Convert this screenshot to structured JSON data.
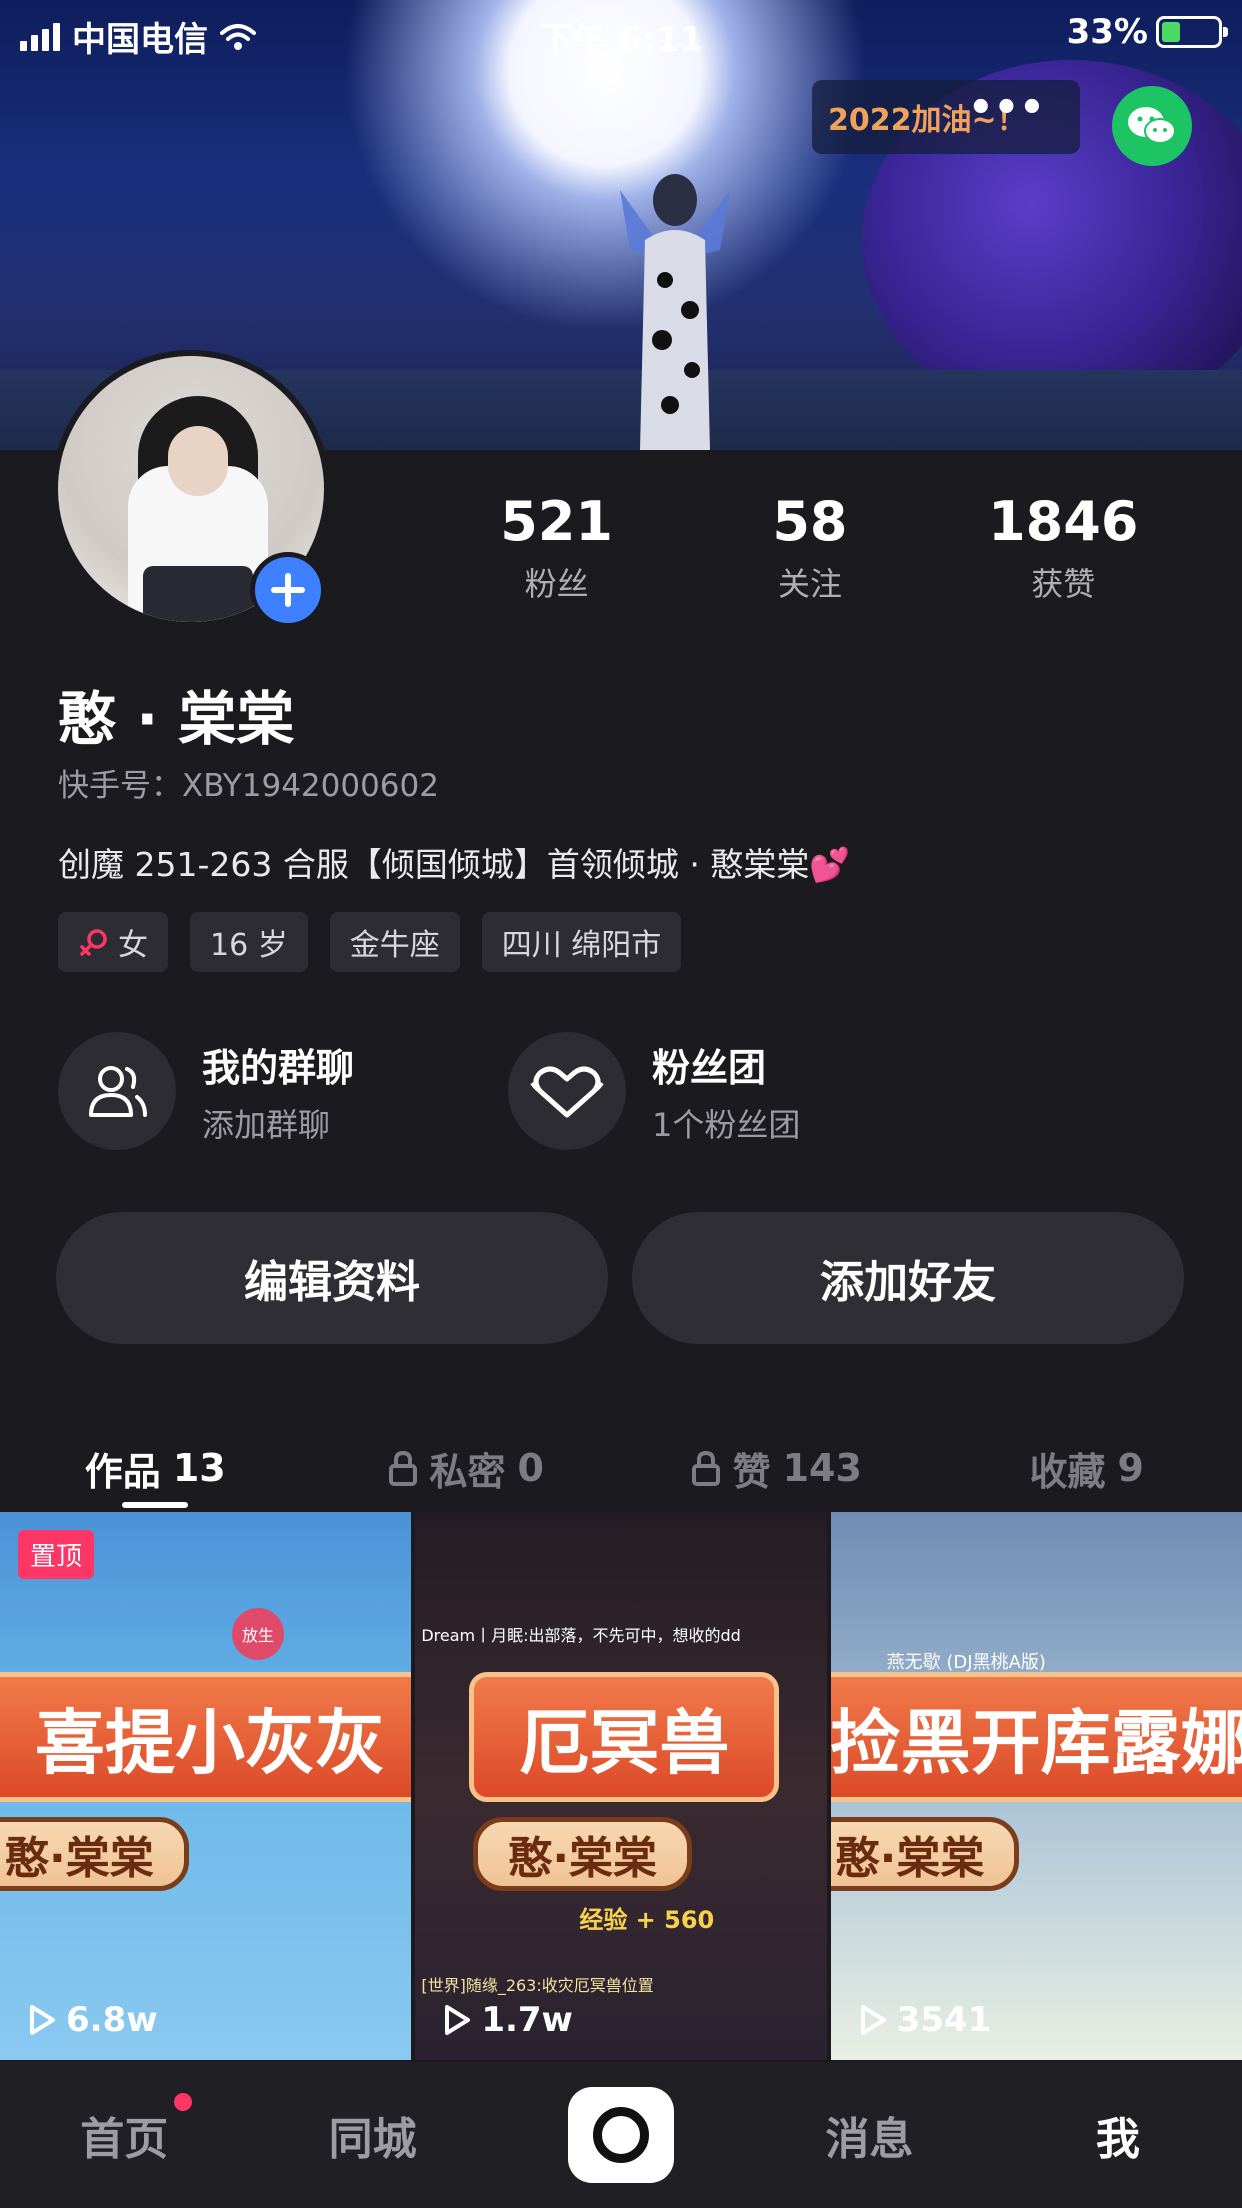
{
  "status_bar": {
    "carrier": "中国电信",
    "time": "下午 6:11",
    "battery_percent": "33%",
    "battery_level": 0.33
  },
  "banner": {
    "bubble_text": "2022加油~！",
    "more_label": "•••"
  },
  "profile": {
    "name": "憨 · 棠棠",
    "kuaishou_id": "快手号：XBY1942000602",
    "bio": "创魔 251-263 合服【倾国倾城】首领倾城 · 憨棠棠💕",
    "stats": [
      {
        "num": "521",
        "label": "粉丝"
      },
      {
        "num": "58",
        "label": "关注"
      },
      {
        "num": "1846",
        "label": "获赞"
      }
    ],
    "tags": {
      "gender": "女",
      "age": "16 岁",
      "zodiac": "金牛座",
      "location": "四川 绵阳市"
    }
  },
  "features": {
    "group_chat": {
      "title": "我的群聊",
      "subtitle": "添加群聊"
    },
    "fan_club": {
      "title": "粉丝团",
      "subtitle": "1个粉丝团"
    }
  },
  "actions": {
    "edit_profile": "编辑资料",
    "add_friend": "添加好友"
  },
  "tabs": [
    {
      "label": "作品",
      "count": "13",
      "locked": false
    },
    {
      "label": "私密",
      "count": "0",
      "locked": true
    },
    {
      "label": "赞",
      "count": "143",
      "locked": true
    },
    {
      "label": "收藏",
      "count": "9",
      "locked": false
    }
  ],
  "videos": [
    {
      "title": "喜提小灰灰",
      "author_plate": "憨·棠棠",
      "plays": "6.8w",
      "pinned_label": "置顶",
      "caption": "放生"
    },
    {
      "title": "厄冥兽",
      "author_plate": "憨·棠棠",
      "plays": "1.7w",
      "caption": "Dream丨月眠:出部落，不先可中，想收的dd",
      "exp": "经验 + 560",
      "world": "[世界]随缘_263:收灾厄冥兽位置"
    },
    {
      "title": "捡黑开库露娜",
      "author_plate": "憨·棠棠",
      "plays": "3541",
      "caption": "燕无歇 (DJ黑桃A版)"
    }
  ],
  "bottom_nav": {
    "home": "首页",
    "local": "同城",
    "messages": "消息",
    "me": "我"
  },
  "colors": {
    "accent_blue": "#3e80ff",
    "pin_red": "#fe3666",
    "wechat_green": "#1dc464",
    "banner_orange": "#f0a25a"
  }
}
